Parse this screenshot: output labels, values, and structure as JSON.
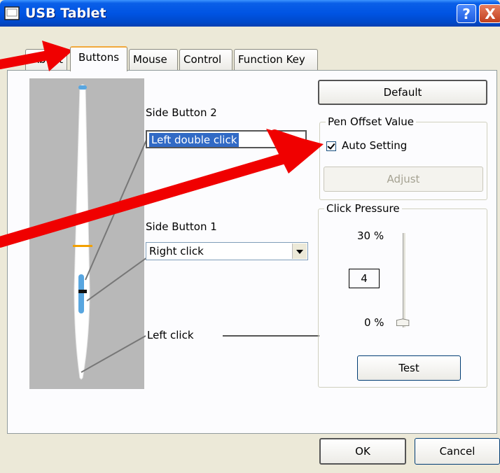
{
  "window": {
    "title": "USB Tablet",
    "help_label": "?",
    "close_label": "X"
  },
  "tabs": [
    {
      "label": "About",
      "active": false
    },
    {
      "label": "Buttons",
      "active": true
    },
    {
      "label": "Mouse",
      "active": false
    },
    {
      "label": "Control",
      "active": false
    },
    {
      "label": "Function Key",
      "active": false
    }
  ],
  "buttons_tab": {
    "side_button_2": {
      "label": "Side Button 2",
      "value": "Left double click"
    },
    "side_button_1": {
      "label": "Side Button 1",
      "value": "Right click"
    },
    "tip": {
      "label": "Left click"
    },
    "default_button": "Default",
    "pen_offset": {
      "title": "Pen Offset Value",
      "auto_setting_label": "Auto Setting",
      "auto_setting_checked": true,
      "adjust_label": "Adjust"
    },
    "click_pressure": {
      "title": "Click Pressure",
      "max_label": "30 %",
      "min_label": "0 %",
      "value": "4",
      "level": 0.0,
      "test_label": "Test"
    }
  },
  "footer": {
    "ok_label": "OK",
    "cancel_label": "Cancel"
  },
  "colors": {
    "titlebar": "#0054E3",
    "annotation_arrow": "#F00000",
    "selection": "#316AC5",
    "pen_marker": "#F2A000"
  }
}
